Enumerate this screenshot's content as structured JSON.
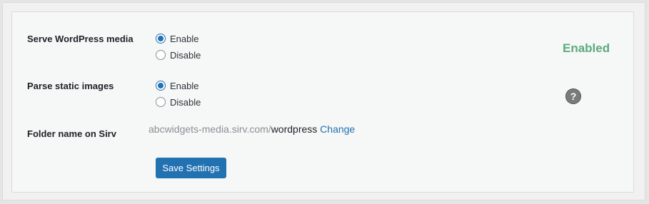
{
  "settings": {
    "serve_media": {
      "label": "Serve WordPress media",
      "options": [
        "Enable",
        "Disable"
      ],
      "selected": "Enable",
      "status": "Enabled"
    },
    "parse_static": {
      "label": "Parse static images",
      "options": [
        "Enable",
        "Disable"
      ],
      "selected": "Enable",
      "help_icon": "question-mark-icon",
      "help_glyph": "?"
    },
    "folder": {
      "label": "Folder name on Sirv",
      "domain": "abcwidgets-media.sirv.com/",
      "path": "wordpress",
      "change_link": "Change"
    }
  },
  "actions": {
    "save_label": "Save Settings"
  },
  "colors": {
    "accent": "#2271b1",
    "status_enabled": "#5cab7d"
  }
}
